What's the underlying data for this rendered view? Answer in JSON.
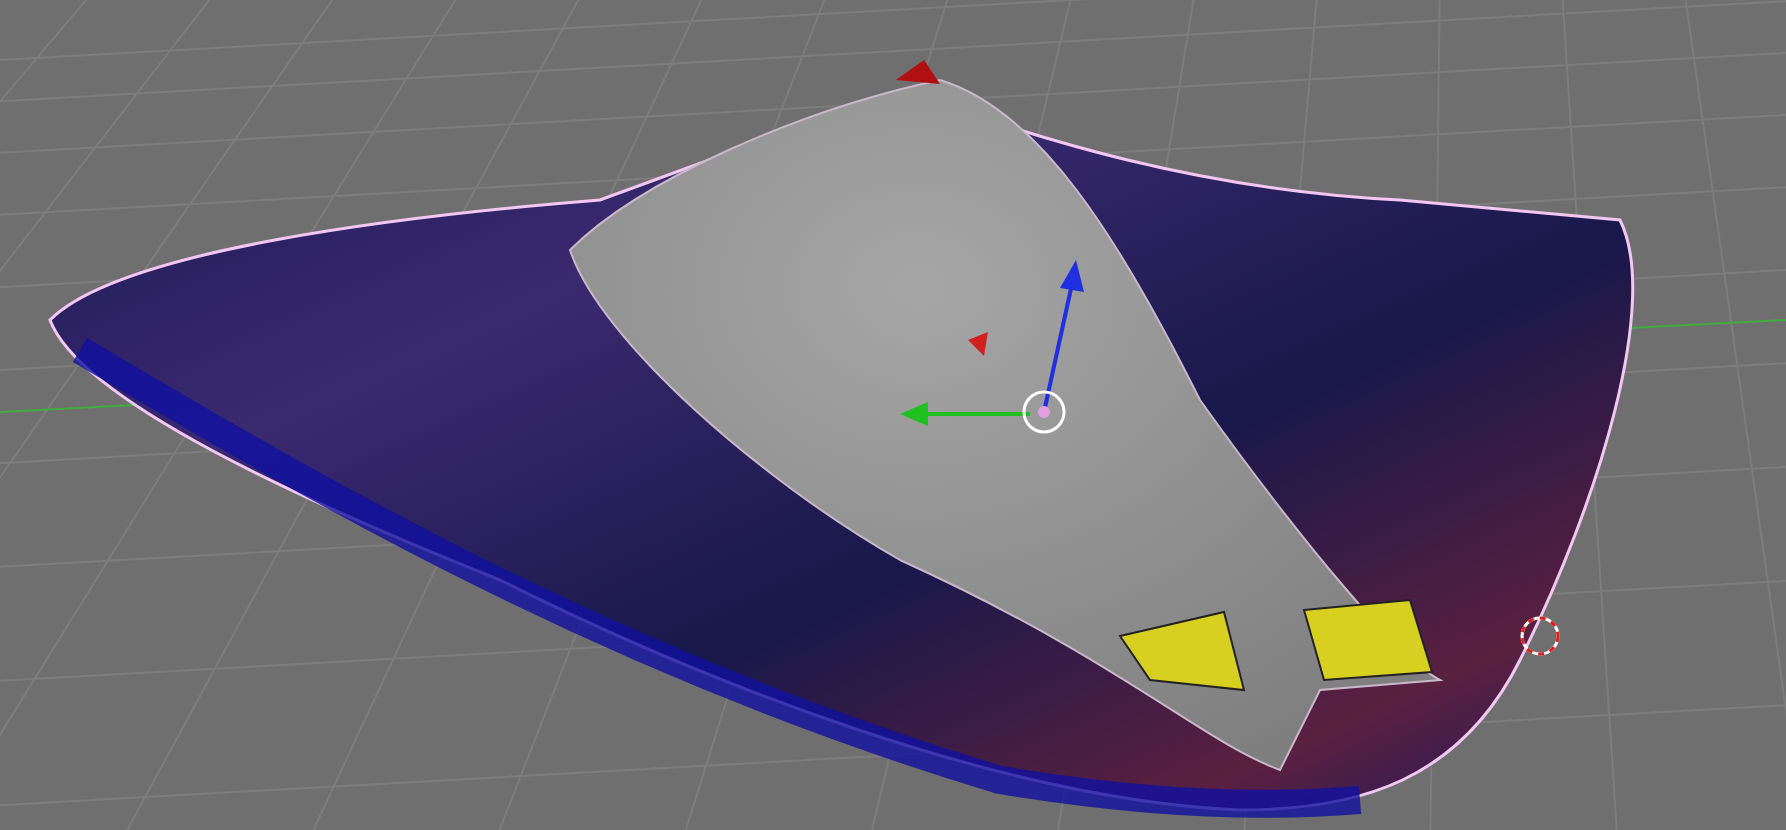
{
  "viewport": {
    "grid": true,
    "transform_gizmo": true,
    "cursor_3d": true
  }
}
